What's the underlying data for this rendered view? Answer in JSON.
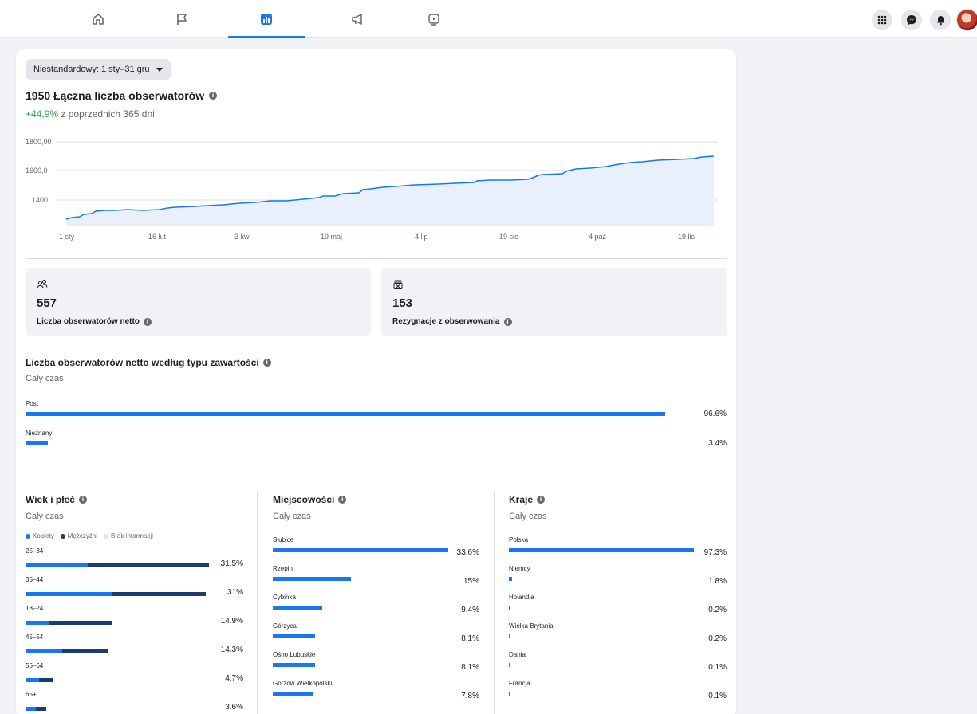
{
  "nav": {
    "tabs": [
      {
        "name": "home-icon"
      },
      {
        "name": "flag-icon"
      },
      {
        "name": "insights-icon",
        "active": true
      },
      {
        "name": "megaphone-icon"
      },
      {
        "name": "video-icon"
      }
    ],
    "right": [
      "menu-grid-icon",
      "messenger-icon",
      "bell-icon",
      "avatar"
    ]
  },
  "date_filter": "Niestandardowy: 1 sty–31 gru",
  "headline": "1950 Łączna liczba obserwatorów",
  "growth": {
    "pct": "+44,9%",
    "text": " z poprzednich 365 dni"
  },
  "chart_data": {
    "type": "area",
    "y_ticks": [
      "1800,00",
      "1600,0",
      "1400"
    ],
    "x_ticks": [
      "1 sty",
      "16 lut",
      "3 kwi",
      "19 maj",
      "4 lip",
      "19 sie",
      "4 paź",
      "19 lis"
    ],
    "color": "#1877f2",
    "fill": "#e7f0fb"
  },
  "stats": [
    {
      "icon": "people-icon",
      "value": "557",
      "label": "Liczba obserwatorów netto"
    },
    {
      "icon": "unfollow-icon",
      "value": "153",
      "label": "Rezygnacje z obserwowania"
    }
  ],
  "content_type": {
    "title": "Liczba obserwatorów netto według typu zawartości",
    "sub": "Cały czas",
    "rows": [
      {
        "label": "Post",
        "pct": "96.6%",
        "value": 96.6
      },
      {
        "label": "Nieznany",
        "pct": "3.4%",
        "value": 3.4
      }
    ]
  },
  "age_gender": {
    "title": "Wiek i płeć",
    "sub": "Cały czas",
    "legend": [
      "Kobiety",
      "Mężczyźni",
      "Brak informacji"
    ],
    "rows": [
      {
        "label": "25–34",
        "pct": "31.5%",
        "women": 31.5,
        "men_share": 0.66
      },
      {
        "label": "35–44",
        "pct": "31%",
        "women": 31,
        "men_share": 0.52
      },
      {
        "label": "18–24",
        "pct": "14.9%",
        "women": 14.9,
        "men_share": 0.72
      },
      {
        "label": "45–54",
        "pct": "14.3%",
        "women": 14.3,
        "men_share": 0.56
      },
      {
        "label": "55–64",
        "pct": "4.7%",
        "women": 4.7,
        "men_share": 0.5
      },
      {
        "label": "65+",
        "pct": "3.6%",
        "women": 3.6,
        "men_share": 0.5
      }
    ]
  },
  "cities": {
    "title": "Miejscowości",
    "sub": "Cały czas",
    "rows": [
      {
        "label": "Słubice",
        "pct": "33.6%",
        "value": 33.6
      },
      {
        "label": "Rzepin",
        "pct": "15%",
        "value": 15
      },
      {
        "label": "Cybinka",
        "pct": "9.4%",
        "value": 9.4
      },
      {
        "label": "Górzyca",
        "pct": "8.1%",
        "value": 8.1
      },
      {
        "label": "Ośno Lubuskie",
        "pct": "8.1%",
        "value": 8.1
      },
      {
        "label": "Gorzów Wielkopolski",
        "pct": "7.8%",
        "value": 7.8
      }
    ]
  },
  "countries": {
    "title": "Kraje",
    "sub": "Cały czas",
    "rows": [
      {
        "label": "Polska",
        "pct": "97.3%",
        "value": 97.3
      },
      {
        "label": "Niemcy",
        "pct": "1.8%",
        "value": 1.8
      },
      {
        "label": "Holandia",
        "pct": "0.2%",
        "value": 0.2
      },
      {
        "label": "Wielka Brytania",
        "pct": "0.2%",
        "value": 0.2
      },
      {
        "label": "Dania",
        "pct": "0.1%",
        "value": 0.1
      },
      {
        "label": "Francja",
        "pct": "0.1%",
        "value": 0.1
      }
    ]
  }
}
